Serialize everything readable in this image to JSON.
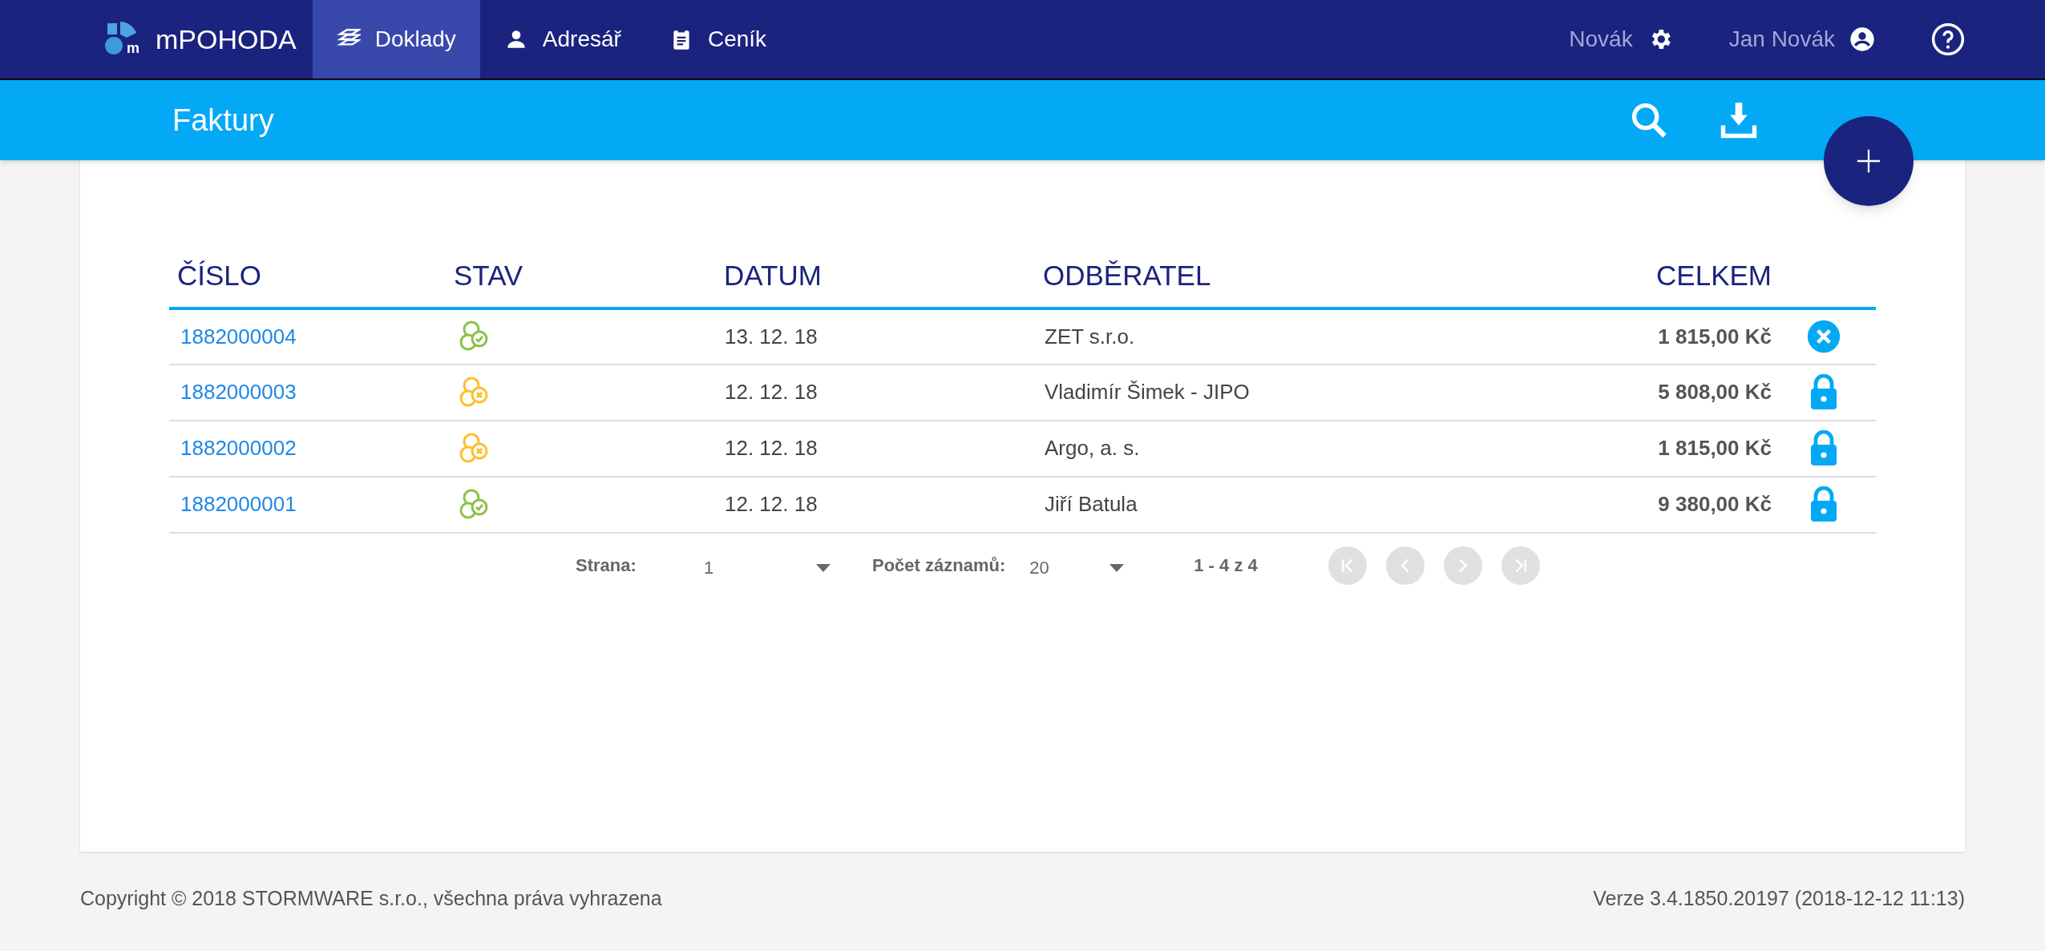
{
  "nav": {
    "logo_mark": "m",
    "brand": "mPOHODA",
    "tabs": [
      {
        "label": "Doklady",
        "selected": true
      },
      {
        "label": "Adresář",
        "selected": false
      },
      {
        "label": "Ceník",
        "selected": false
      }
    ],
    "company": "Novák",
    "user": "Jan Novák"
  },
  "toolbar": {
    "title": "Faktury"
  },
  "table": {
    "columns": [
      "ČÍSLO",
      "STAV",
      "DATUM",
      "ODBĚRATEL",
      "CELKEM"
    ],
    "rows": [
      {
        "number": "1882000004",
        "status": {
          "kind": "ok"
        },
        "date": "13. 12. 18",
        "customer": "ZET s.r.o.",
        "total": "1 815,00 Kč",
        "action": {
          "kind": "cancel"
        }
      },
      {
        "number": "1882000003",
        "status": {
          "kind": "error"
        },
        "date": "12. 12. 18",
        "customer": "Vladimír Šimek - JIPO",
        "total": "5 808,00 Kč",
        "action": {
          "kind": "locked"
        }
      },
      {
        "number": "1882000002",
        "status": {
          "kind": "error"
        },
        "date": "12. 12. 18",
        "customer": "Argo, a. s.",
        "total": "1 815,00 Kč",
        "action": {
          "kind": "locked"
        }
      },
      {
        "number": "1882000001",
        "status": {
          "kind": "ok"
        },
        "date": "12. 12. 18",
        "customer": "Jiří Batula",
        "total": "9 380,00 Kč",
        "action": {
          "kind": "locked"
        }
      }
    ]
  },
  "pagination": {
    "page_label": "Strana:",
    "page": "1",
    "count_label": "Počet záznamů:",
    "count": "20",
    "range": "1 - 4 z 4",
    "first_disabled": true,
    "prev_disabled": true,
    "next_disabled": true,
    "last_disabled": true
  },
  "footer": {
    "copyright": "Copyright © 2018 STORMWARE s.r.o., všechna práva vyhrazena",
    "version": "Verze 3.4.1850.20197 (2018-12-12 11:13)"
  }
}
